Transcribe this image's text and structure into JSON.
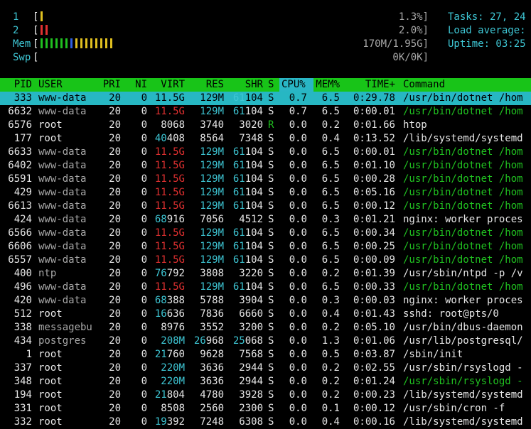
{
  "meters": {
    "cpu1": {
      "label": "1",
      "bars": [
        {
          "color": "#e0c020"
        }
      ],
      "pct": "1.3%]"
    },
    "cpu2": {
      "label": "2",
      "bars": [
        {
          "color": "#e03030"
        },
        {
          "color": "#e03030"
        }
      ],
      "pct": "2.0%]"
    },
    "mem": {
      "label": "Mem",
      "bars_green": 6,
      "bars_blue": 1,
      "bars_yellow": 8,
      "value": "170M/1.95G]"
    },
    "swp": {
      "label": "Swp",
      "value": "0K/0K]"
    }
  },
  "summary": {
    "tasks": "Tasks: 27, 24",
    "load": "Load average:",
    "uptime": "Uptime: 03:25"
  },
  "columns": [
    "PID",
    "USER",
    "PRI",
    "NI",
    "VIRT",
    "RES",
    "SHR",
    "S",
    "CPU%",
    "MEM%",
    "TIME+",
    "Command"
  ],
  "processes": [
    {
      "pid": "333",
      "user": "www-data",
      "pri": "20",
      "ni": "0",
      "virt": "11.5G",
      "res": "129M",
      "shr": "61104",
      "s": "S",
      "cpu": "0.7",
      "mem": "6.5",
      "time": "0:29.78",
      "cmd": "/usr/bin/dotnet /hom",
      "selected": true,
      "thread": false,
      "virt_red": true,
      "res_cyan": true,
      "user_gray": false
    },
    {
      "pid": "6632",
      "user": "www-data",
      "pri": "20",
      "ni": "0",
      "virt": "11.5G",
      "res": "129M",
      "shr": "61104",
      "s": "S",
      "cpu": "0.7",
      "mem": "6.5",
      "time": "0:00.01",
      "cmd": "/usr/bin/dotnet /hom",
      "selected": false,
      "thread": true,
      "virt_red": true,
      "res_cyan": true,
      "user_gray": true
    },
    {
      "pid": "6576",
      "user": "root",
      "pri": "20",
      "ni": "0",
      "virt": "8068",
      "res": "3740",
      "shr": "3020",
      "s": "R",
      "cpu": "0.0",
      "mem": "0.2",
      "time": "0:01.66",
      "cmd": "htop",
      "selected": false,
      "thread": false,
      "virt_red": false,
      "res_cyan": false,
      "user_gray": false
    },
    {
      "pid": "177",
      "user": "root",
      "pri": "20",
      "ni": "0",
      "virt": "40408",
      "res": "8564",
      "shr": "7348",
      "s": "S",
      "cpu": "0.0",
      "mem": "0.4",
      "time": "0:13.52",
      "cmd": "/lib/systemd/systemd",
      "selected": false,
      "thread": false,
      "virt_red": false,
      "res_cyan": false,
      "user_gray": false
    },
    {
      "pid": "6633",
      "user": "www-data",
      "pri": "20",
      "ni": "0",
      "virt": "11.5G",
      "res": "129M",
      "shr": "61104",
      "s": "S",
      "cpu": "0.0",
      "mem": "6.5",
      "time": "0:00.01",
      "cmd": "/usr/bin/dotnet /hom",
      "selected": false,
      "thread": true,
      "virt_red": true,
      "res_cyan": true,
      "user_gray": true
    },
    {
      "pid": "6402",
      "user": "www-data",
      "pri": "20",
      "ni": "0",
      "virt": "11.5G",
      "res": "129M",
      "shr": "61104",
      "s": "S",
      "cpu": "0.0",
      "mem": "6.5",
      "time": "0:01.10",
      "cmd": "/usr/bin/dotnet /hom",
      "selected": false,
      "thread": true,
      "virt_red": true,
      "res_cyan": true,
      "user_gray": true
    },
    {
      "pid": "6591",
      "user": "www-data",
      "pri": "20",
      "ni": "0",
      "virt": "11.5G",
      "res": "129M",
      "shr": "61104",
      "s": "S",
      "cpu": "0.0",
      "mem": "6.5",
      "time": "0:00.28",
      "cmd": "/usr/bin/dotnet /hom",
      "selected": false,
      "thread": true,
      "virt_red": true,
      "res_cyan": true,
      "user_gray": true
    },
    {
      "pid": "429",
      "user": "www-data",
      "pri": "20",
      "ni": "0",
      "virt": "11.5G",
      "res": "129M",
      "shr": "61104",
      "s": "S",
      "cpu": "0.0",
      "mem": "6.5",
      "time": "0:05.16",
      "cmd": "/usr/bin/dotnet /hom",
      "selected": false,
      "thread": true,
      "virt_red": true,
      "res_cyan": true,
      "user_gray": true
    },
    {
      "pid": "6613",
      "user": "www-data",
      "pri": "20",
      "ni": "0",
      "virt": "11.5G",
      "res": "129M",
      "shr": "61104",
      "s": "S",
      "cpu": "0.0",
      "mem": "6.5",
      "time": "0:00.12",
      "cmd": "/usr/bin/dotnet /hom",
      "selected": false,
      "thread": true,
      "virt_red": true,
      "res_cyan": true,
      "user_gray": true
    },
    {
      "pid": "424",
      "user": "www-data",
      "pri": "20",
      "ni": "0",
      "virt": "68916",
      "res": "7056",
      "shr": "4512",
      "s": "S",
      "cpu": "0.0",
      "mem": "0.3",
      "time": "0:01.21",
      "cmd": "nginx: worker proces",
      "selected": false,
      "thread": false,
      "virt_red": false,
      "res_cyan": false,
      "user_gray": true
    },
    {
      "pid": "6566",
      "user": "www-data",
      "pri": "20",
      "ni": "0",
      "virt": "11.5G",
      "res": "129M",
      "shr": "61104",
      "s": "S",
      "cpu": "0.0",
      "mem": "6.5",
      "time": "0:00.34",
      "cmd": "/usr/bin/dotnet /hom",
      "selected": false,
      "thread": true,
      "virt_red": true,
      "res_cyan": true,
      "user_gray": true
    },
    {
      "pid": "6606",
      "user": "www-data",
      "pri": "20",
      "ni": "0",
      "virt": "11.5G",
      "res": "129M",
      "shr": "61104",
      "s": "S",
      "cpu": "0.0",
      "mem": "6.5",
      "time": "0:00.25",
      "cmd": "/usr/bin/dotnet /hom",
      "selected": false,
      "thread": true,
      "virt_red": true,
      "res_cyan": true,
      "user_gray": true
    },
    {
      "pid": "6557",
      "user": "www-data",
      "pri": "20",
      "ni": "0",
      "virt": "11.5G",
      "res": "129M",
      "shr": "61104",
      "s": "S",
      "cpu": "0.0",
      "mem": "6.5",
      "time": "0:00.09",
      "cmd": "/usr/bin/dotnet /hom",
      "selected": false,
      "thread": true,
      "virt_red": true,
      "res_cyan": true,
      "user_gray": true
    },
    {
      "pid": "400",
      "user": "ntp",
      "pri": "20",
      "ni": "0",
      "virt": "76792",
      "res": "3808",
      "shr": "3220",
      "s": "S",
      "cpu": "0.0",
      "mem": "0.2",
      "time": "0:01.39",
      "cmd": "/usr/sbin/ntpd -p /v",
      "selected": false,
      "thread": false,
      "virt_red": false,
      "res_cyan": false,
      "user_gray": true
    },
    {
      "pid": "496",
      "user": "www-data",
      "pri": "20",
      "ni": "0",
      "virt": "11.5G",
      "res": "129M",
      "shr": "61104",
      "s": "S",
      "cpu": "0.0",
      "mem": "6.5",
      "time": "0:00.33",
      "cmd": "/usr/bin/dotnet /hom",
      "selected": false,
      "thread": true,
      "virt_red": true,
      "res_cyan": true,
      "user_gray": true
    },
    {
      "pid": "420",
      "user": "www-data",
      "pri": "20",
      "ni": "0",
      "virt": "68388",
      "res": "5788",
      "shr": "3904",
      "s": "S",
      "cpu": "0.0",
      "mem": "0.3",
      "time": "0:00.03",
      "cmd": "nginx: worker proces",
      "selected": false,
      "thread": false,
      "virt_red": false,
      "res_cyan": false,
      "user_gray": true
    },
    {
      "pid": "512",
      "user": "root",
      "pri": "20",
      "ni": "0",
      "virt": "16636",
      "res": "7836",
      "shr": "6660",
      "s": "S",
      "cpu": "0.0",
      "mem": "0.4",
      "time": "0:01.43",
      "cmd": "sshd: root@pts/0",
      "selected": false,
      "thread": false,
      "virt_red": false,
      "res_cyan": false,
      "user_gray": false
    },
    {
      "pid": "338",
      "user": "messagebu",
      "pri": "20",
      "ni": "0",
      "virt": "8976",
      "res": "3552",
      "shr": "3200",
      "s": "S",
      "cpu": "0.0",
      "mem": "0.2",
      "time": "0:05.10",
      "cmd": "/usr/bin/dbus-daemon",
      "selected": false,
      "thread": false,
      "virt_red": false,
      "res_cyan": false,
      "user_gray": true
    },
    {
      "pid": "434",
      "user": "postgres",
      "pri": "20",
      "ni": "0",
      "virt": "208M",
      "res": "26968",
      "shr": "25068",
      "s": "S",
      "cpu": "0.0",
      "mem": "1.3",
      "time": "0:01.06",
      "cmd": "/usr/lib/postgresql/",
      "selected": false,
      "thread": false,
      "virt_red": false,
      "res_cyan": false,
      "user_gray": true
    },
    {
      "pid": "1",
      "user": "root",
      "pri": "20",
      "ni": "0",
      "virt": "21760",
      "res": "9628",
      "shr": "7568",
      "s": "S",
      "cpu": "0.0",
      "mem": "0.5",
      "time": "0:03.87",
      "cmd": "/sbin/init",
      "selected": false,
      "thread": false,
      "virt_red": false,
      "res_cyan": false,
      "user_gray": false
    },
    {
      "pid": "337",
      "user": "root",
      "pri": "20",
      "ni": "0",
      "virt": "220M",
      "res": "3636",
      "shr": "2944",
      "s": "S",
      "cpu": "0.0",
      "mem": "0.2",
      "time": "0:02.55",
      "cmd": "/usr/sbin/rsyslogd -",
      "selected": false,
      "thread": false,
      "virt_red": false,
      "res_cyan": false,
      "user_gray": false
    },
    {
      "pid": "348",
      "user": "root",
      "pri": "20",
      "ni": "0",
      "virt": "220M",
      "res": "3636",
      "shr": "2944",
      "s": "S",
      "cpu": "0.0",
      "mem": "0.2",
      "time": "0:01.24",
      "cmd": "/usr/sbin/rsyslogd -",
      "selected": false,
      "thread": true,
      "virt_red": false,
      "res_cyan": false,
      "user_gray": false
    },
    {
      "pid": "194",
      "user": "root",
      "pri": "20",
      "ni": "0",
      "virt": "21804",
      "res": "4780",
      "shr": "3928",
      "s": "S",
      "cpu": "0.0",
      "mem": "0.2",
      "time": "0:00.23",
      "cmd": "/lib/systemd/systemd",
      "selected": false,
      "thread": false,
      "virt_red": false,
      "res_cyan": false,
      "user_gray": false
    },
    {
      "pid": "331",
      "user": "root",
      "pri": "20",
      "ni": "0",
      "virt": "8508",
      "res": "2560",
      "shr": "2300",
      "s": "S",
      "cpu": "0.0",
      "mem": "0.1",
      "time": "0:00.12",
      "cmd": "/usr/sbin/cron -f",
      "selected": false,
      "thread": false,
      "virt_red": false,
      "res_cyan": false,
      "user_gray": false
    },
    {
      "pid": "332",
      "user": "root",
      "pri": "20",
      "ni": "0",
      "virt": "19392",
      "res": "7248",
      "shr": "6308",
      "s": "S",
      "cpu": "0.0",
      "mem": "0.4",
      "time": "0:00.16",
      "cmd": "/lib/systemd/systemd",
      "selected": false,
      "thread": false,
      "virt_red": false,
      "res_cyan": false,
      "user_gray": false
    }
  ]
}
